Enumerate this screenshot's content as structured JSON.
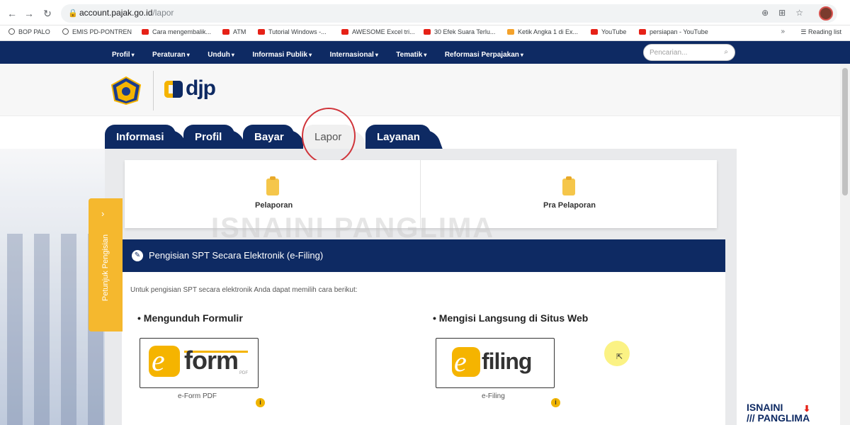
{
  "browser": {
    "url_domain": "account.pajak.go.id",
    "url_path": "/lapor",
    "bookmarks": [
      "BOP PALO",
      "EMIS PD-PONTREN",
      "Cara mengembalik...",
      "ATM",
      "Tutorial Windows -...",
      "AWESOME Excel tri...",
      "30 Efek Suara Terlu...",
      "Ketik Angka 1 di Ex...",
      "YouTube",
      "persiapan - YouTube"
    ],
    "reading_list": "Reading list"
  },
  "site_nav": {
    "items": [
      "Profil",
      "Peraturan",
      "Unduh",
      "Informasi Publik",
      "Internasional",
      "Tematik",
      "Reformasi Perpajakan"
    ],
    "search_placeholder": "Pencarian..."
  },
  "header": {
    "logo_text": "djp"
  },
  "tabs": [
    "Informasi",
    "Profil",
    "Bayar",
    "Lapor",
    "Layanan"
  ],
  "cards": {
    "pelaporan": "Pelaporan",
    "pra_pelaporan": "Pra Pelaporan"
  },
  "watermark": "ISNAINI PANGLIMA",
  "efiling_section": {
    "title": "Pengisian SPT Secara Elektronik (e-Filing)",
    "intro": "Untuk pengisian SPT secara elektronik Anda dapat memilih cara berikut:",
    "method_left_title": "• Mengunduh Formulir",
    "method_right_title": "• Mengisi Langsung di Situs Web",
    "eform_logo_e": "e",
    "eform_logo_word": "form",
    "eform_logo_pdf": "PDF",
    "eform_caption": "e-Form PDF",
    "efiling_logo_e": "e",
    "efiling_logo_word": "filing",
    "efiling_caption": "e-Filing"
  },
  "side_tab": {
    "label": "Petunjuk Pengisian"
  },
  "channel": {
    "line1": "ISNAINI",
    "line2": "/// PANGLIMA"
  },
  "colors": {
    "navy": "#0e2a63",
    "accent_yellow": "#f5b400",
    "sidetab_yellow": "#f5b82e",
    "circle_red": "#d0343a"
  },
  "icons": {
    "back": "arrow-left-icon",
    "forward": "arrow-right-icon",
    "reload": "reload-icon",
    "lock": "lock-icon",
    "search": "search-icon",
    "pencil": "pencil-icon",
    "info": "info-icon",
    "clipboard": "clipboard-icon"
  }
}
